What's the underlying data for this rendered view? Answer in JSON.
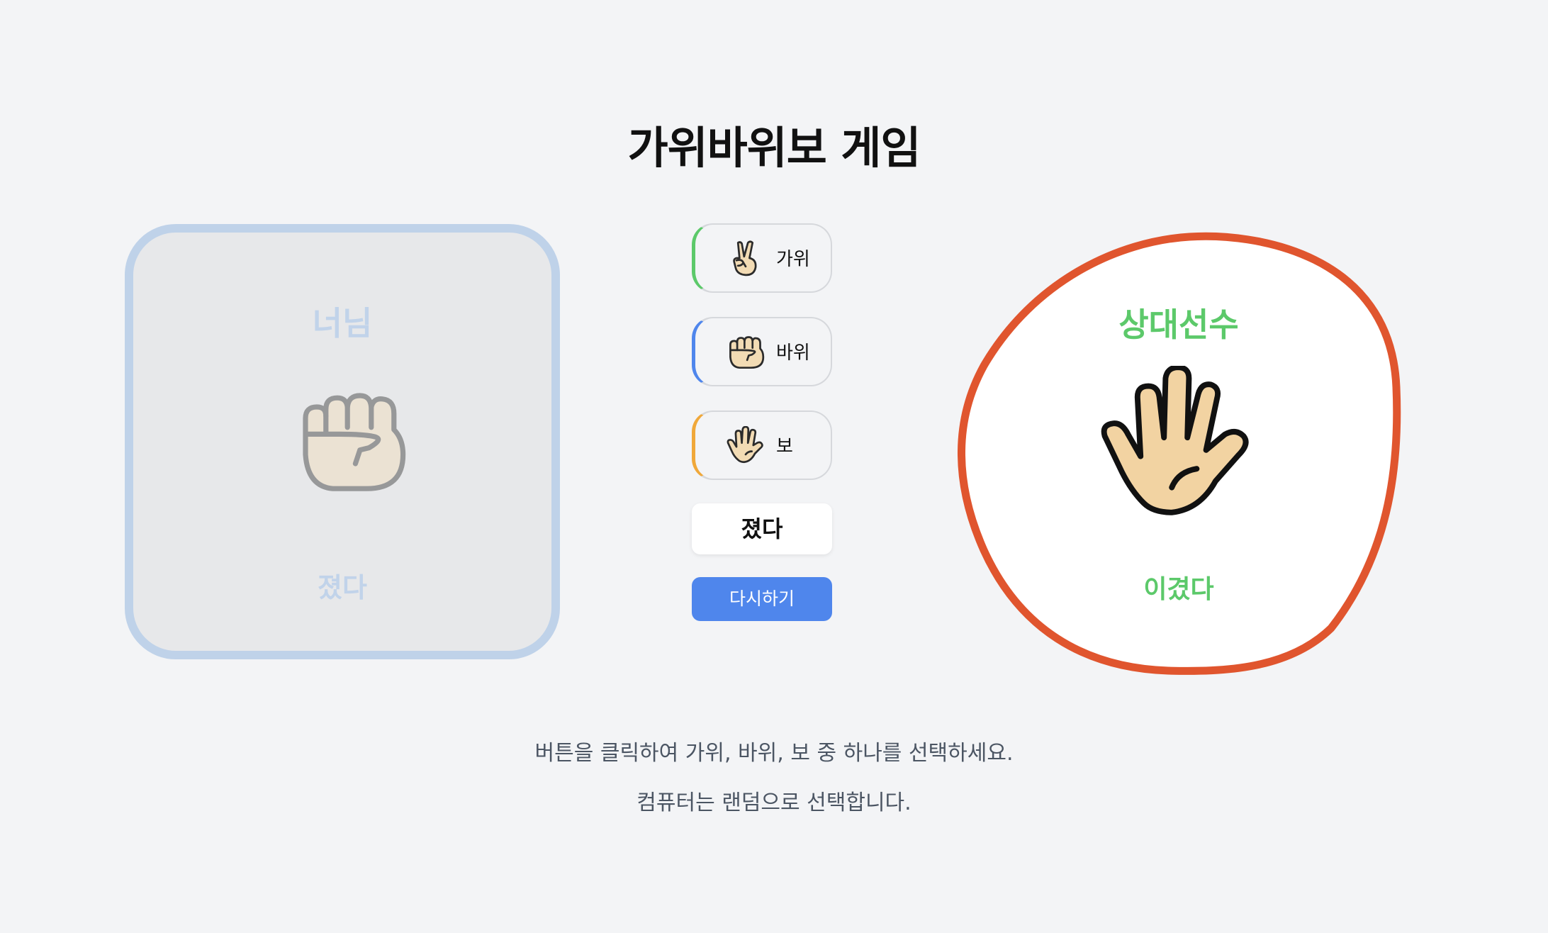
{
  "title": "가위바위보 게임",
  "player": {
    "name": "너님",
    "hand_icon": "fist-icon",
    "result": "졌다",
    "border_color": "#bfd2e9"
  },
  "choices": [
    {
      "label": "가위",
      "icon": "victory-hand-icon",
      "accent": "#5cc96a"
    },
    {
      "label": "바위",
      "icon": "fist-icon",
      "accent": "#4f86ec"
    },
    {
      "label": "보",
      "icon": "open-hand-icon",
      "accent": "#f0a83a"
    }
  ],
  "result_text": "졌다",
  "retry_label": "다시하기",
  "opponent": {
    "name": "상대선수",
    "hand_icon": "open-hand-icon",
    "result": "이겼다",
    "border_color": "#e0552e",
    "accent": "#5cc96a"
  },
  "instructions": [
    "버튼을 클릭하여 가위, 바위, 보 중 하나를 선택하세요.",
    "컴퓨터는 랜덤으로 선택합니다."
  ]
}
